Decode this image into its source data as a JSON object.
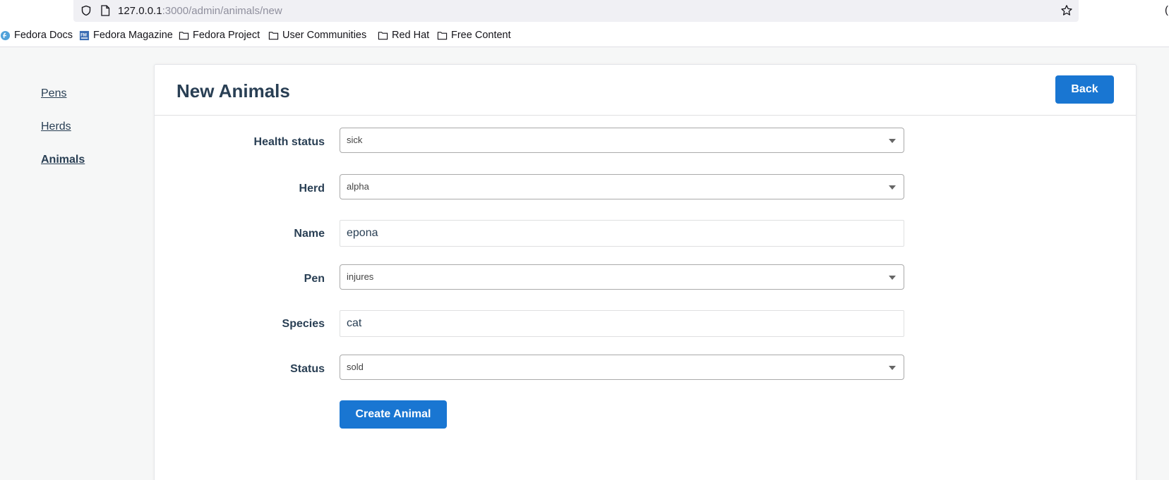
{
  "browser": {
    "url_host": "127.0.0.1",
    "url_path": ":3000/admin/animals/new",
    "bookmarks": [
      {
        "label": "Fedora Docs",
        "icon": "fedora-icon"
      },
      {
        "label": "Fedora Magazine",
        "icon": "fedora-magazine-icon"
      },
      {
        "label": "Fedora Project",
        "icon": "folder-icon"
      },
      {
        "label": "User Communities",
        "icon": "folder-icon"
      },
      {
        "label": "Red Hat",
        "icon": "folder-icon"
      },
      {
        "label": "Free Content",
        "icon": "folder-icon"
      }
    ]
  },
  "sidebar": {
    "items": [
      {
        "label": "Pens",
        "active": false
      },
      {
        "label": "Herds",
        "active": false
      },
      {
        "label": "Animals",
        "active": true
      }
    ]
  },
  "header": {
    "title": "New Animals",
    "back_label": "Back"
  },
  "form": {
    "fields": [
      {
        "label": "Health status",
        "type": "select",
        "value": "sick"
      },
      {
        "label": "Herd",
        "type": "select",
        "value": "alpha"
      },
      {
        "label": "Name",
        "type": "text",
        "value": "epona"
      },
      {
        "label": "Pen",
        "type": "select",
        "value": "injures"
      },
      {
        "label": "Species",
        "type": "text",
        "value": "cat"
      },
      {
        "label": "Status",
        "type": "select",
        "value": "sold"
      }
    ],
    "submit_label": "Create Animal"
  },
  "colors": {
    "primary": "#1976d2",
    "text": "#293f54",
    "background": "#f6f7f7"
  }
}
